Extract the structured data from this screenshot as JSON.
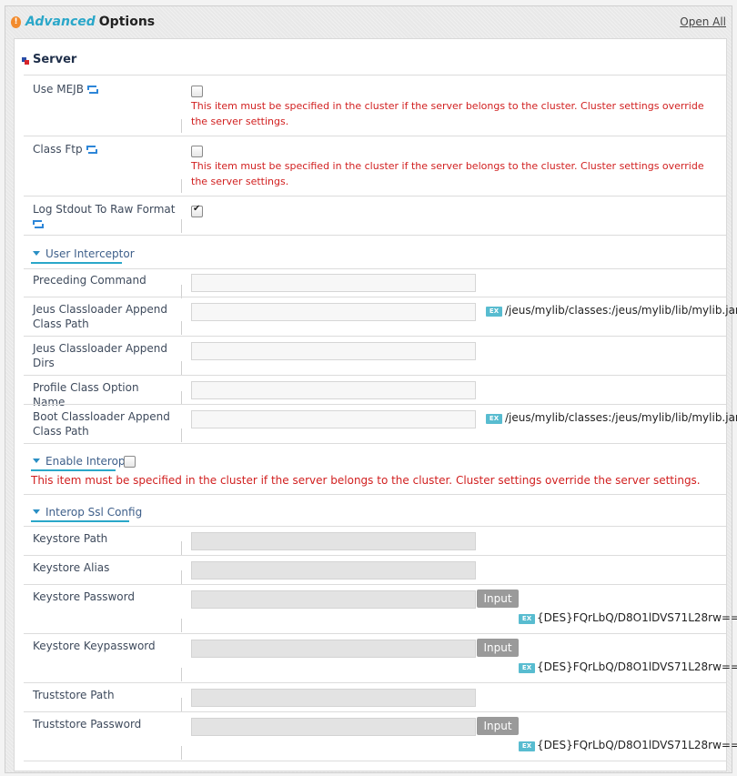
{
  "header": {
    "title_accent": "Advanced",
    "title_rest": "Options",
    "open_all": "Open All"
  },
  "server_section": {
    "title": "Server"
  },
  "warning_text": "This item must be specified in the cluster if the server belongs to the cluster. Cluster settings override the server settings.",
  "fields": {
    "use_mejb": {
      "label": "Use MEJB",
      "checked": false
    },
    "class_ftp": {
      "label": "Class Ftp",
      "checked": false
    },
    "log_stdout": {
      "label": "Log Stdout To Raw Format",
      "checked": true
    }
  },
  "user_interceptor": {
    "title": "User Interceptor",
    "preceding_command": {
      "label": "Preceding Command",
      "value": ""
    },
    "jeus_classloader_append_class_path": {
      "label": "Jeus Classloader Append Class Path",
      "value": "",
      "example": "/jeus/mylib/classes:/jeus/mylib/lib/mylib.jar"
    },
    "jeus_classloader_append_dirs": {
      "label": "Jeus Classloader Append Dirs",
      "value": ""
    },
    "profile_class_option_name": {
      "label": "Profile Class Option Name",
      "value": ""
    },
    "boot_classloader_append_class_path": {
      "label": "Boot Classloader Append Class Path",
      "value": "",
      "example": "/jeus/mylib/classes:/jeus/mylib/lib/mylib.jar"
    }
  },
  "enable_interop": {
    "title": "Enable Interop",
    "checked": false
  },
  "interop_ssl": {
    "title": "Interop Ssl Config",
    "keystore_path": {
      "label": "Keystore Path",
      "value": ""
    },
    "keystore_alias": {
      "label": "Keystore Alias",
      "value": ""
    },
    "keystore_password": {
      "label": "Keystore Password",
      "value": "",
      "example": "{DES}FQrLbQ/D8O1lDVS71L28rw=="
    },
    "keystore_keypassword": {
      "label": "Keystore Keypassword",
      "value": "",
      "example": "{DES}FQrLbQ/D8O1lDVS71L28rw=="
    },
    "truststore_path": {
      "label": "Truststore Path",
      "value": ""
    },
    "truststore_password": {
      "label": "Truststore Password",
      "value": "",
      "example": "{DES}FQrLbQ/D8O1lDVS71L28rw=="
    }
  },
  "button_input": "Input",
  "ex_badge": "EX",
  "colors": {
    "accent": "#2aa7c9",
    "warning": "#d11f1f",
    "button": "#9a9a9a"
  }
}
